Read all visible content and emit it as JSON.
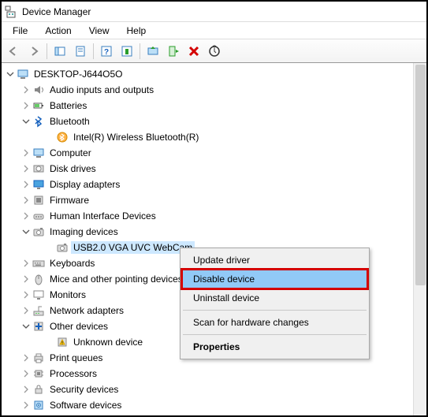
{
  "title": "Device Manager",
  "menu": {
    "file": "File",
    "action": "Action",
    "view": "View",
    "help": "Help"
  },
  "toolbar": {
    "back": "back",
    "forward": "forward",
    "show_hide": "show-hide",
    "properties_sheet": "properties",
    "help": "help",
    "action_props": "action-properties",
    "update": "update-driver",
    "enable": "enable-device",
    "disable": "disable-device",
    "uninstall": "uninstall-device",
    "scan": "scan-hardware"
  },
  "tree": {
    "root": "DESKTOP-J644O5O",
    "items": [
      {
        "label": "Audio inputs and outputs",
        "icon": "audio"
      },
      {
        "label": "Batteries",
        "icon": "battery"
      },
      {
        "label": "Bluetooth",
        "icon": "bluetooth",
        "expanded": true,
        "children": [
          {
            "label": "Intel(R) Wireless Bluetooth(R)",
            "icon": "bt-device"
          }
        ]
      },
      {
        "label": "Computer",
        "icon": "computer"
      },
      {
        "label": "Disk drives",
        "icon": "disk"
      },
      {
        "label": "Display adapters",
        "icon": "display"
      },
      {
        "label": "Firmware",
        "icon": "firmware"
      },
      {
        "label": "Human Interface Devices",
        "icon": "hid"
      },
      {
        "label": "Imaging devices",
        "icon": "camera",
        "expanded": true,
        "children": [
          {
            "label": "USB2.0 VGA UVC WebCam",
            "icon": "camera",
            "selected": true
          }
        ]
      },
      {
        "label": "Keyboards",
        "icon": "keyboard"
      },
      {
        "label": "Mice and other pointing devices",
        "icon": "mouse"
      },
      {
        "label": "Monitors",
        "icon": "monitor"
      },
      {
        "label": "Network adapters",
        "icon": "network"
      },
      {
        "label": "Other devices",
        "icon": "other",
        "expanded": true,
        "children": [
          {
            "label": "Unknown device",
            "icon": "warn"
          }
        ]
      },
      {
        "label": "Print queues",
        "icon": "printer"
      },
      {
        "label": "Processors",
        "icon": "cpu"
      },
      {
        "label": "Security devices",
        "icon": "security"
      },
      {
        "label": "Software devices",
        "icon": "software"
      }
    ]
  },
  "context_menu": {
    "update": "Update driver",
    "disable": "Disable device",
    "uninstall": "Uninstall device",
    "scan": "Scan for hardware changes",
    "properties": "Properties"
  }
}
